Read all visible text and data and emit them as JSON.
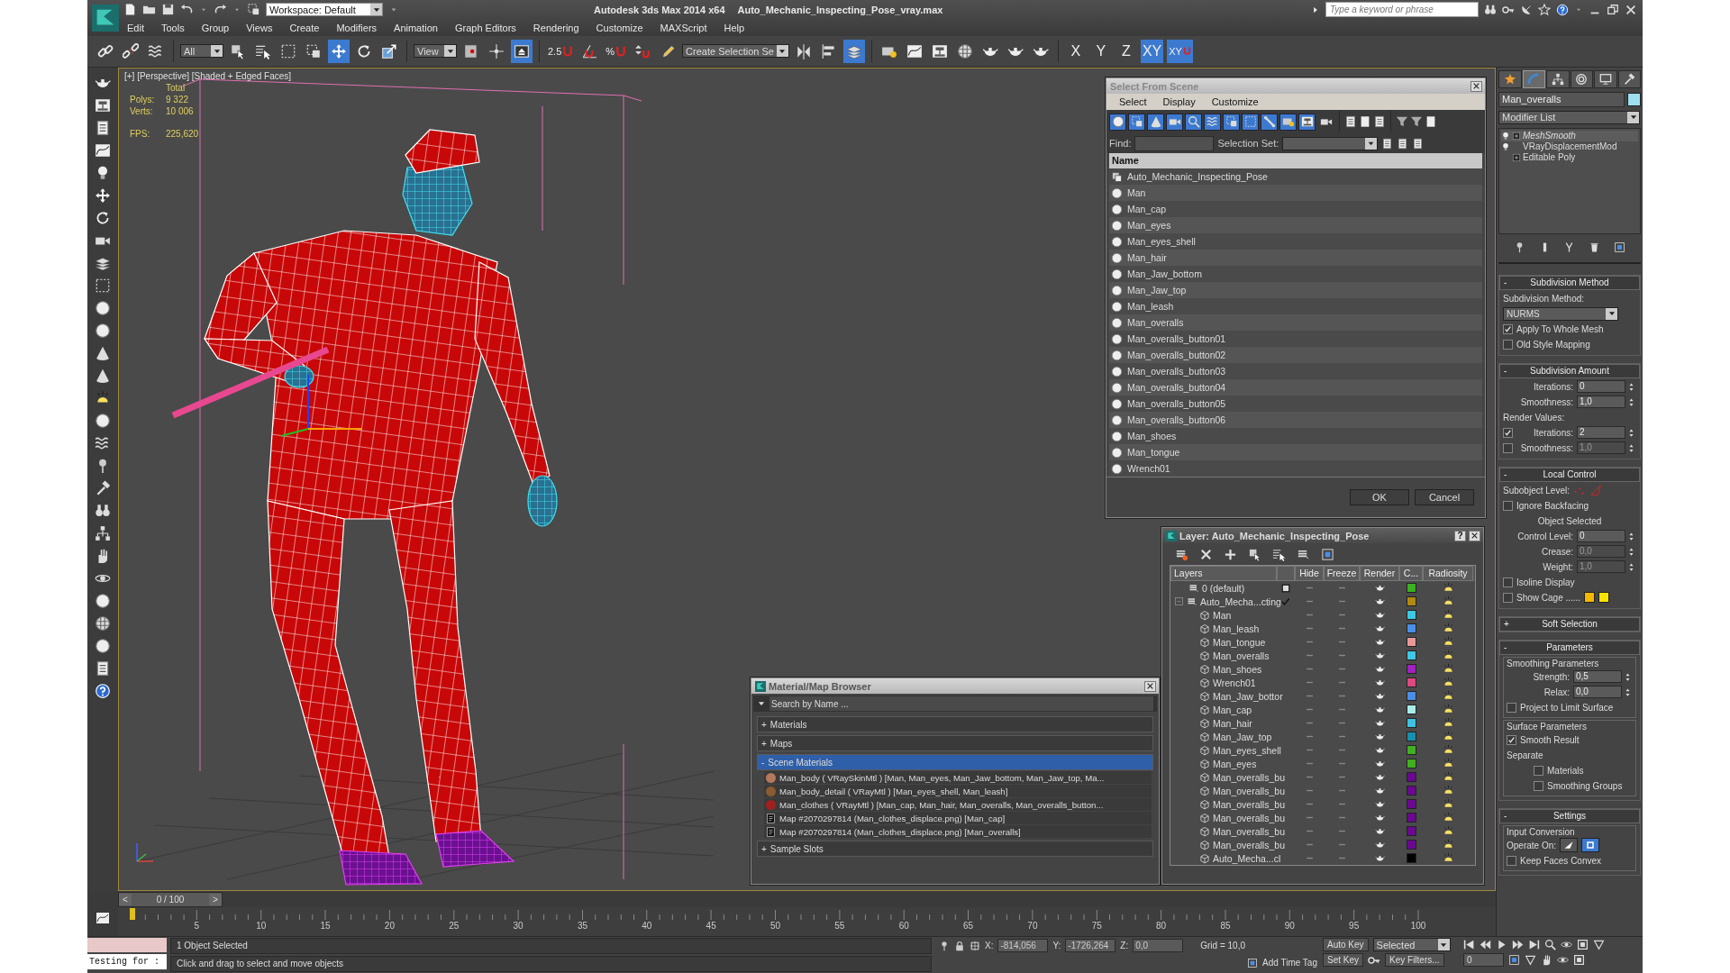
{
  "window": {
    "app_title": "Autodesk 3ds Max  2014 x64",
    "file_title": "Auto_Mechanic_Inspecting_Pose_vray.max"
  },
  "workspace": "Workspace: Default",
  "search": {
    "placeholder": "Type a keyword or phrase"
  },
  "menu": [
    "Edit",
    "Tools",
    "Group",
    "Views",
    "Create",
    "Modifiers",
    "Animation",
    "Graph Editors",
    "Rendering",
    "Customize",
    "MAXScript",
    "Help"
  ],
  "toolbar": [
    {
      "kind": "link",
      "selected": false
    },
    {
      "kind": "unlink",
      "selected": false
    },
    {
      "kind": "wave",
      "selected": false
    },
    {
      "kind": "dropdown",
      "value": "All"
    },
    {
      "kind": "select",
      "selected": false
    },
    {
      "kind": "selectname",
      "selected": false
    },
    {
      "kind": "rect",
      "selected": false
    },
    {
      "kind": "window",
      "selected": false
    },
    {
      "kind": "move",
      "selected": true
    },
    {
      "kind": "rotate",
      "selected": false
    },
    {
      "kind": "scale",
      "selected": false
    },
    {
      "kind": "dropdown",
      "value": "View"
    },
    {
      "kind": "pivot",
      "selected": false
    },
    {
      "kind": "manip",
      "selected": false
    },
    {
      "kind": "keyboard",
      "selected": true
    },
    {
      "kind": "snap",
      "label": "2.5",
      "selected": false
    },
    {
      "kind": "angle",
      "selected": false
    },
    {
      "kind": "snap",
      "label": "%",
      "selected": false
    },
    {
      "kind": "spinner",
      "selected": false
    },
    {
      "kind": "pencil",
      "selected": false
    },
    {
      "kind": "dropdown",
      "value": "Create Selection Se"
    },
    {
      "kind": "mirror",
      "selected": false
    },
    {
      "kind": "align",
      "selected": false
    },
    {
      "kind": "layers",
      "selected": true
    },
    {
      "kind": "explorer",
      "selected": false
    },
    {
      "kind": "graph",
      "selected": false
    },
    {
      "kind": "schematic",
      "selected": false
    },
    {
      "kind": "material",
      "selected": false
    },
    {
      "kind": "teapot",
      "selected": false
    },
    {
      "kind": "teapot",
      "selected": false
    },
    {
      "kind": "teapot",
      "selected": false
    },
    {
      "kind": "axis",
      "label": "X",
      "selected": false
    },
    {
      "kind": "axis",
      "label": "Y",
      "selected": false
    },
    {
      "kind": "axis",
      "label": "Z",
      "selected": false
    },
    {
      "kind": "axis",
      "label": "XY",
      "selected": true
    },
    {
      "kind": "axis_snap",
      "label": "XY",
      "selected": true
    }
  ],
  "viewport": {
    "label": "[+] [Perspective] [Shaded + Edged Faces]",
    "stats": {
      "heading": "Total",
      "rows": [
        {
          "label": "Polys:",
          "value": "9 322"
        },
        {
          "label": "Verts:",
          "value": "10 006"
        }
      ],
      "fps_label": "FPS:",
      "fps": "225,620"
    }
  },
  "timeline": {
    "prev": "<",
    "position": "0 / 100",
    "next": ">",
    "frame_labels": [
      "5",
      "10",
      "15",
      "20",
      "25",
      "30",
      "35",
      "40",
      "45",
      "50",
      "55",
      "60",
      "65",
      "70",
      "75",
      "80",
      "85",
      "90",
      "95",
      "100"
    ]
  },
  "select_from_scene": {
    "title": "Select From Scene",
    "menu": [
      "Select",
      "Display",
      "Customize"
    ],
    "filters": [
      {
        "kind": "sphere",
        "selected": true
      },
      {
        "kind": "window",
        "selected": true
      },
      {
        "kind": "cone",
        "selected": true
      },
      {
        "kind": "camera",
        "selected": true
      },
      {
        "kind": "zoom",
        "selected": true
      },
      {
        "kind": "wave",
        "selected": true
      },
      {
        "kind": "window",
        "selected": true
      },
      {
        "kind": "rect",
        "selected": true
      },
      {
        "kind": "bone",
        "selected": true
      },
      {
        "kind": "explorer",
        "selected": true
      },
      {
        "kind": "schematic",
        "selected": true
      },
      {
        "kind": "camera",
        "selected": false
      }
    ],
    "find_label": "Find:",
    "selection_set_label": "Selection Set:",
    "column": "Name",
    "items": [
      {
        "kind": "group",
        "name": "Auto_Mechanic_Inspecting_Pose",
        "selected": false
      },
      {
        "kind": "object",
        "name": "Man",
        "selected": false
      },
      {
        "kind": "object",
        "name": "Man_cap",
        "selected": false
      },
      {
        "kind": "object",
        "name": "Man_eyes",
        "selected": false
      },
      {
        "kind": "object",
        "name": "Man_eyes_shell",
        "selected": false
      },
      {
        "kind": "object",
        "name": "Man_hair",
        "selected": false
      },
      {
        "kind": "object",
        "name": "Man_Jaw_bottom",
        "selected": false
      },
      {
        "kind": "object",
        "name": "Man_Jaw_top",
        "selected": false
      },
      {
        "kind": "object",
        "name": "Man_leash",
        "selected": false
      },
      {
        "kind": "object",
        "name": "Man_overalls",
        "selected": false
      },
      {
        "kind": "object",
        "name": "Man_overalls_button01",
        "selected": false
      },
      {
        "kind": "object",
        "name": "Man_overalls_button02",
        "selected": false
      },
      {
        "kind": "object",
        "name": "Man_overalls_button03",
        "selected": false
      },
      {
        "kind": "object",
        "name": "Man_overalls_button04",
        "selected": false
      },
      {
        "kind": "object",
        "name": "Man_overalls_button05",
        "selected": false
      },
      {
        "kind": "object",
        "name": "Man_overalls_button06",
        "selected": false
      },
      {
        "kind": "object",
        "name": "Man_shoes",
        "selected": false
      },
      {
        "kind": "object",
        "name": "Man_tongue",
        "selected": false
      },
      {
        "kind": "object",
        "name": "Wrench01",
        "selected": false
      }
    ],
    "buttons": [
      "OK",
      "Cancel"
    ]
  },
  "layer_manager": {
    "title": "Layer: Auto_Mechanic_Inspecting_Pose",
    "help": "?",
    "columns": [
      "Layers",
      "Hide",
      "Freeze",
      "Render",
      "C...",
      "Radiosity"
    ],
    "layers": [
      {
        "name": "0 (default)",
        "current": false,
        "color": "#3cb020"
      },
      {
        "name": "Auto_Mecha...cting",
        "current": true,
        "expanded": true,
        "color": "#b08a10",
        "children": [
          {
            "name": "Man",
            "color": "#3cc8e6"
          },
          {
            "name": "Man_leash",
            "color": "#4a8ee8"
          },
          {
            "name": "Man_tongue",
            "color": "#e89898"
          },
          {
            "name": "Man_overalls",
            "color": "#3cc8e6"
          },
          {
            "name": "Man_shoes",
            "color": "#a020c0"
          },
          {
            "name": "Wrench01",
            "color": "#e04880"
          },
          {
            "name": "Man_Jaw_bottor",
            "color": "#4a8ee8"
          },
          {
            "name": "Man_cap",
            "color": "#a8ece8"
          },
          {
            "name": "Man_hair",
            "color": "#40c0e0"
          },
          {
            "name": "Man_Jaw_top",
            "color": "#1890b0"
          },
          {
            "name": "Man_eyes_shell",
            "color": "#40b020"
          },
          {
            "name": "Man_eyes",
            "color": "#40b020"
          },
          {
            "name": "Man_overalls_bu",
            "color": "#6a0890"
          },
          {
            "name": "Man_overalls_bu",
            "color": "#6a0890"
          },
          {
            "name": "Man_overalls_bu",
            "color": "#6a0890"
          },
          {
            "name": "Man_overalls_bu",
            "color": "#6a0890"
          },
          {
            "name": "Man_overalls_bu",
            "color": "#6a0890"
          },
          {
            "name": "Man_overalls_bu",
            "color": "#6a0890"
          },
          {
            "name": "Auto_Mecha...cl",
            "color": "#000000"
          }
        ]
      }
    ]
  },
  "material_browser": {
    "title": "Material/Map Browser",
    "search": {
      "placeholder": "Search by Name ..."
    },
    "groups": [
      {
        "toggle": "+",
        "label": "Materials",
        "selected": false
      },
      {
        "toggle": "+",
        "label": "Maps",
        "selected": false
      },
      {
        "toggle": "-",
        "label": "Scene Materials",
        "selected": true,
        "items": [
          {
            "kind": "material",
            "color": "#b5785a",
            "name": "Man_body  ( VRaySkinMtl ) [Man, Man_eyes, Man_Jaw_bottom, Man_Jaw_top, Ma..."
          },
          {
            "kind": "material",
            "color": "#8a5a30",
            "name": "Man_body_detail  ( VRayMtl ) [Man_eyes_shell, Man_leash]"
          },
          {
            "kind": "material",
            "color": "#a02020",
            "name": "Man_clothes  ( VRayMtl ) [Man_cap, Man_hair, Man_overalls, Man_overalls_button..."
          },
          {
            "kind": "map",
            "name": "Map #2070297814 (Man_clothes_displace.png) [Man_cap]"
          },
          {
            "kind": "map",
            "name": "Map #2070297814 (Man_clothes_displace.png) [Man_overalls]"
          }
        ]
      },
      {
        "toggle": "+",
        "label": "Sample Slots",
        "selected": false
      }
    ]
  },
  "command_panel": {
    "tabs": [
      {
        "kind": "create",
        "selected": false
      },
      {
        "kind": "modify",
        "selected": true
      },
      {
        "kind": "hierarchy",
        "selected": false
      },
      {
        "kind": "motion",
        "selected": false
      },
      {
        "kind": "display",
        "selected": false
      },
      {
        "kind": "utilities",
        "selected": false
      }
    ],
    "object_name": "Man_overalls",
    "object_swatch": {
      "color": "#9ee0f0"
    },
    "modifier_list": "Modifier List",
    "stack": [
      {
        "label": "MeshSmooth",
        "instanced": true,
        "bulb": true,
        "expandable": true
      },
      {
        "label": "VRayDisplacementMod",
        "instanced": false,
        "bulb": true,
        "expandable": false
      },
      {
        "label": "Editable Poly",
        "instanced": false,
        "bulb": false,
        "expandable": true
      }
    ],
    "rollouts": [
      {
        "toggle": "-",
        "title": "Subdivision Method",
        "controls": [
          {
            "kind": "label",
            "text": "Subdivision Method:"
          },
          {
            "kind": "dropdown",
            "value": "NURMS"
          },
          {
            "kind": "checkbox",
            "label": "Apply To Whole Mesh",
            "checked": true
          },
          {
            "kind": "checkbox",
            "label": "Old Style Mapping",
            "checked": false
          }
        ]
      },
      {
        "toggle": "-",
        "title": "Subdivision Amount",
        "controls": [
          {
            "kind": "spinner",
            "label": "Iterations:",
            "value": "0",
            "disabled": false
          },
          {
            "kind": "spinner",
            "label": "Smoothness:",
            "value": "1,0",
            "disabled": false
          },
          {
            "kind": "label",
            "text": "Render Values:"
          },
          {
            "kind": "check_spinner",
            "label": "Iterations:",
            "value": "2",
            "checked": true,
            "disabled": false
          },
          {
            "kind": "check_spinner",
            "label": "Smoothness:",
            "value": "1,0",
            "checked": false,
            "disabled": true
          }
        ]
      },
      {
        "toggle": "-",
        "title": "Local Control",
        "controls": [
          {
            "kind": "subobject",
            "label": "Subobject Level:"
          },
          {
            "kind": "checkbox",
            "label": "Ignore Backfacing",
            "checked": false
          },
          {
            "kind": "heading",
            "text": "Object Selected"
          },
          {
            "kind": "spinner",
            "label": "Control Level:",
            "value": "0",
            "disabled": false
          },
          {
            "kind": "spinner",
            "label": "Crease:",
            "value": "0,0",
            "disabled": true
          },
          {
            "kind": "spinner",
            "label": "Weight:",
            "value": "1,0",
            "disabled": true
          },
          {
            "kind": "checkbox",
            "label": "Isoline Display",
            "checked": false
          },
          {
            "kind": "swatch_check",
            "label": "Show Cage ......",
            "checked": false,
            "swatches": [
              {
                "color": "#f5b800"
              },
              {
                "color": "#f8e400"
              }
            ]
          }
        ]
      },
      {
        "toggle": "+",
        "title": "Soft Selection"
      },
      {
        "toggle": "-",
        "title": "Parameters",
        "controls": [
          {
            "kind": "group",
            "title": "Smoothing Parameters",
            "controls": [
              {
                "kind": "spinner",
                "label": "Strength:",
                "value": "0,5",
                "disabled": false
              },
              {
                "kind": "spinner",
                "label": "Relax:",
                "value": "0,0",
                "disabled": false
              },
              {
                "kind": "checkbox",
                "label": "Project to Limit Surface",
                "checked": false
              }
            ]
          },
          {
            "kind": "group",
            "title": "Surface Parameters",
            "controls": [
              {
                "kind": "checkbox",
                "label": "Smooth Result",
                "checked": true
              },
              {
                "kind": "label",
                "text": "Separate"
              },
              {
                "kind": "subcheckbox",
                "label": "Materials",
                "checked": false
              },
              {
                "kind": "subcheckbox",
                "label": "Smoothing Groups",
                "checked": false
              }
            ]
          }
        ]
      },
      {
        "toggle": "-",
        "title": "Settings",
        "controls": [
          {
            "kind": "group",
            "title": "Input Conversion",
            "controls": [
              {
                "kind": "operate",
                "label": "Operate On:",
                "options": [
                  {
                    "kind": "triangle",
                    "selected": false
                  },
                  {
                    "kind": "square",
                    "selected": true
                  }
                ]
              },
              {
                "kind": "checkbox",
                "label": "Keep Faces Convex",
                "checked": false
              }
            ]
          }
        ]
      }
    ]
  },
  "status": {
    "listener": "Testing for :",
    "prompt": "1 Object Selected",
    "hint": "Click and drag to select and move objects",
    "coords": [
      {
        "label": "X:",
        "value": "-814,056"
      },
      {
        "label": "Y:",
        "value": "-1726,264"
      },
      {
        "label": "Z:",
        "value": "0,0"
      }
    ],
    "grid": "Grid = 10,0",
    "add_time_tag": "Add Time Tag",
    "auto_key": {
      "label": "Auto Key",
      "on": false
    },
    "key_mode": "Selected",
    "set_key": "Set Key",
    "key_filters": "Key Filters...",
    "frame": "0"
  }
}
